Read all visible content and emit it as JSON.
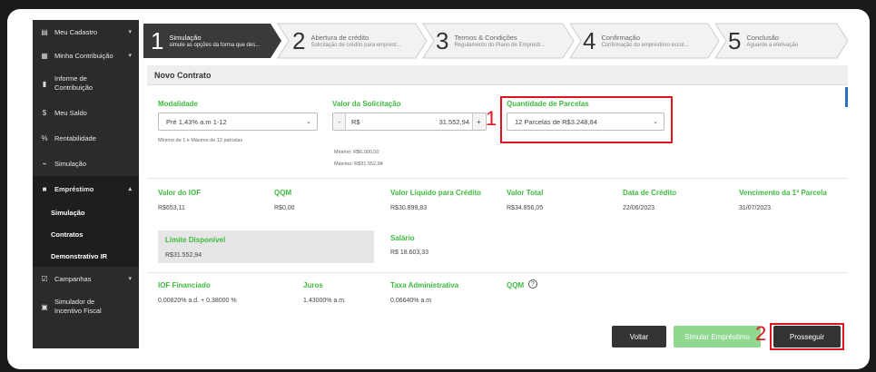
{
  "sidebar": {
    "items": [
      {
        "icon": "id-card-icon",
        "label": "Meu Cadastro",
        "chevron": "▾"
      },
      {
        "icon": "calculator-icon",
        "label": "Minha Contribuição",
        "chevron": "▾"
      },
      {
        "icon": "document-icon",
        "label": "Informe de Contribuição"
      },
      {
        "icon": "dollar-icon",
        "label": "Meu Saldo"
      },
      {
        "icon": "percent-icon",
        "label": "Rentabilidade"
      },
      {
        "icon": "chart-icon",
        "label": "Simulação"
      },
      {
        "icon": "briefcase-icon",
        "label": "Empréstimo",
        "chevron": "▴"
      }
    ],
    "subitems": [
      "Simulação",
      "Contratos",
      "Demonstrativo IR"
    ],
    "bottom_items": [
      {
        "icon": "campaign-icon",
        "label": "Campanhas",
        "chevron": "▾"
      },
      {
        "icon": "simulator-icon",
        "label": "Simulador de Incentivo Fiscal"
      }
    ]
  },
  "stepper": [
    {
      "num": "1",
      "title": "Simulação",
      "subtitle": "simule as opções da forma que des..."
    },
    {
      "num": "2",
      "title": "Abertura de crédito",
      "subtitle": "Solicitação de crédito para emprest..."
    },
    {
      "num": "3",
      "title": "Termos & Condições",
      "subtitle": "Regulamento do Plano de Emprésti..."
    },
    {
      "num": "4",
      "title": "Confirmação",
      "subtitle": "Confirmação do empréstimo escol..."
    },
    {
      "num": "5",
      "title": "Conclusão",
      "subtitle": "Aguarde a efetivação"
    }
  ],
  "main": {
    "header": "Novo Contrato",
    "modalidade": {
      "label": "Modalidade",
      "value": "Pré 1,43% a.m 1-12",
      "hint": "Mínimo de 1 e Máximo de 12 parcelas"
    },
    "valor_solicitacao": {
      "label": "Valor da Solicitação",
      "minus": "-",
      "currency": "R$",
      "value": "31.552,94",
      "plus": "+",
      "min": "Mínimo: R$6.000,00",
      "max": "Máximo: R$31.552,94"
    },
    "parcelas": {
      "label": "Quantidade de Parcelas",
      "value": "12 Parcelas de R$3.248,84"
    },
    "row2": [
      {
        "label": "Valor do IOF",
        "value": "R$653,11"
      },
      {
        "label": "QQM",
        "value": "R$0,00"
      },
      {
        "label": "Valor Líquido para Crédito",
        "value": "R$30.899,83"
      },
      {
        "label": "Valor Total",
        "value": "R$34.856,05"
      },
      {
        "label": "Data de Crédito",
        "value": "22/06/2023"
      },
      {
        "label": "Vencimento da 1ª Parcela",
        "value": "31/07/2023"
      }
    ],
    "limite": {
      "label": "Limite Disponível",
      "value": "R$31.552,94"
    },
    "salario": {
      "label": "Salário",
      "value": "R$ 18.603,33"
    },
    "row4": [
      {
        "label": "IOF Financiado",
        "value": "0,00820% a.d. + 0,38000 %"
      },
      {
        "label": "Juros",
        "value": "1,43000% a.m."
      },
      {
        "label": "Taxa Administrativa",
        "value": "0,06640% a.m"
      },
      {
        "label": "QQM",
        "value": ""
      }
    ],
    "buttons": {
      "voltar": "Voltar",
      "simular": "Simular Empréstimo",
      "prosseguir": "Prosseguir"
    },
    "annotations": {
      "one": "1",
      "two": "2"
    }
  },
  "colors": {
    "green": "#3dbb3d",
    "dark": "#2b2b2b",
    "red": "#e0141e"
  }
}
